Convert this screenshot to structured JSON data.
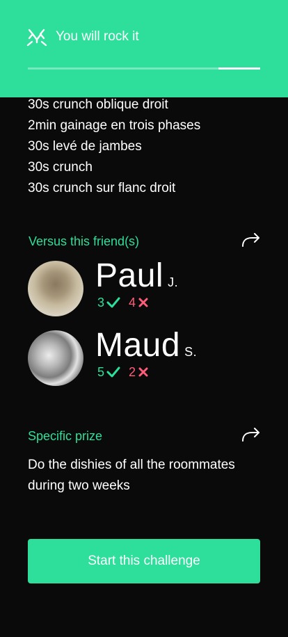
{
  "header": {
    "title": "You will rock it",
    "progress": 0.82
  },
  "exercises": [
    "30s crunch oblique droit",
    "2min gainage en trois phases",
    "30s levé de jambes",
    "30s crunch",
    "30s crunch sur flanc droit"
  ],
  "friends_section": {
    "title": "Versus this friend(s)",
    "share_icon": "share-arrow-icon",
    "friends": [
      {
        "name": "Paul",
        "initial": "J.",
        "wins": "3",
        "losses": "4"
      },
      {
        "name": "Maud",
        "initial": "S.",
        "wins": "5",
        "losses": "2"
      }
    ]
  },
  "prize_section": {
    "title": "Specific prize",
    "text": "Do the dishies of all the roommates during two weeks",
    "share_icon": "share-arrow-icon"
  },
  "cta": {
    "label": "Start this challenge"
  },
  "colors": {
    "accent": "#2ddf9b",
    "loss": "#ff5c7a",
    "background": "#0a0a0a"
  }
}
